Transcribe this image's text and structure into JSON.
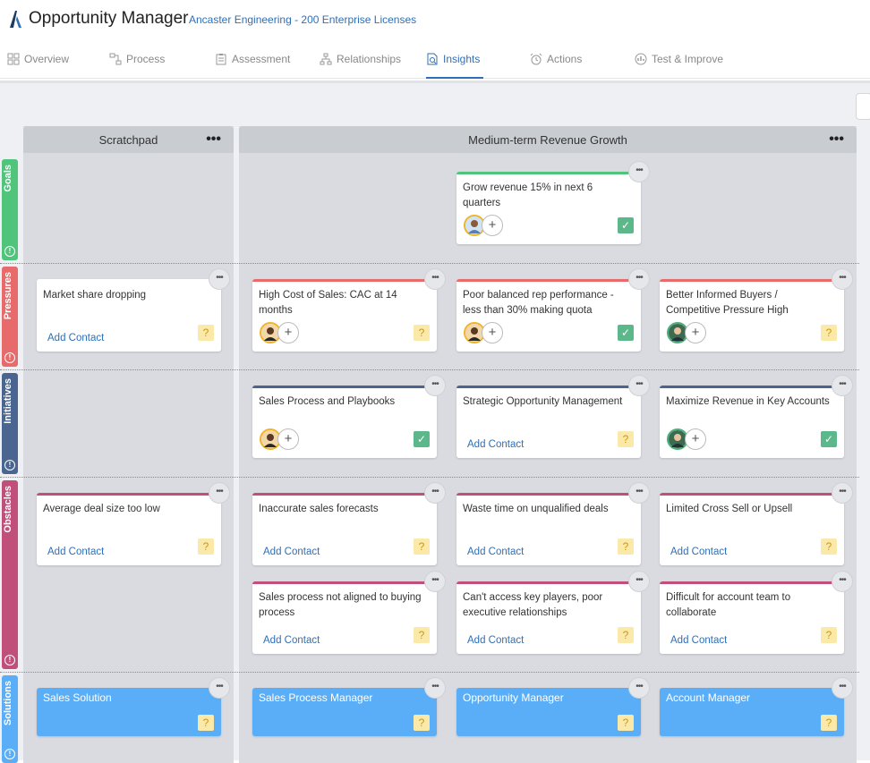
{
  "header": {
    "app_title": "Opportunity Manager",
    "account": "Ancaster Engineering - 200 Enterprise Licenses"
  },
  "tabs": [
    {
      "label": "Overview",
      "icon": "grid-icon"
    },
    {
      "label": "Process",
      "icon": "process-icon"
    },
    {
      "label": "Assessment",
      "icon": "clipboard-icon"
    },
    {
      "label": "Relationships",
      "icon": "org-chart-icon"
    },
    {
      "label": "Insights",
      "icon": "insights-icon",
      "active": true
    },
    {
      "label": "Actions",
      "icon": "alarm-icon"
    },
    {
      "label": "Test & Improve",
      "icon": "gauge-icon"
    }
  ],
  "columns": {
    "scratchpad": {
      "title": "Scratchpad"
    },
    "main": {
      "title": "Medium-term Revenue Growth"
    }
  },
  "rows": {
    "goals": "Goals",
    "pressures": "Pressures",
    "initiatives": "Initiatives",
    "obstacles": "Obstacles",
    "solutions": "Solutions"
  },
  "cards": {
    "goal1": {
      "title": "Grow revenue 15% in next 6 quarters"
    },
    "p0": {
      "title": "Market share dropping",
      "add": "Add Contact"
    },
    "p1": {
      "title": "High Cost of Sales: CAC at 14 months"
    },
    "p2": {
      "title": "Poor balanced rep performance - less than 30% making quota"
    },
    "p3": {
      "title": "Better Informed Buyers / Competitive Pressure High"
    },
    "i1": {
      "title": "Sales Process and Playbooks"
    },
    "i2": {
      "title": "Strategic Opportunity Management",
      "add": "Add Contact"
    },
    "i3": {
      "title": "Maximize Revenue in Key Accounts"
    },
    "o0": {
      "title": "Average deal size too low",
      "add": "Add Contact"
    },
    "o1": {
      "title": "Inaccurate sales forecasts",
      "add": "Add Contact"
    },
    "o2": {
      "title": "Waste time on unqualified deals",
      "add": "Add Contact"
    },
    "o3": {
      "title": "Limited Cross Sell or Upsell",
      "add": "Add Contact"
    },
    "o4": {
      "title": "Sales process not aligned to buying process",
      "add": "Add Contact"
    },
    "o5": {
      "title": "Can't access key players, poor executive relationships",
      "add": "Add Contact"
    },
    "o6": {
      "title": "Difficult for account team to collaborate",
      "add": "Add Contact"
    },
    "s0": {
      "title": "Sales Solution"
    },
    "s1": {
      "title": "Sales Process Manager"
    },
    "s2": {
      "title": "Opportunity Manager"
    },
    "s3": {
      "title": "Account Manager"
    }
  },
  "glyphs": {
    "more": "•••",
    "plus": "+",
    "question": "?",
    "check": "✓",
    "info": "!"
  },
  "colors": {
    "accent": "#2f6fb7",
    "goals": "#4fc47a",
    "pressures": "#e86b6b",
    "initiatives": "#4a6690",
    "obstacles": "#c0507a",
    "solutions": "#5aaef7"
  }
}
